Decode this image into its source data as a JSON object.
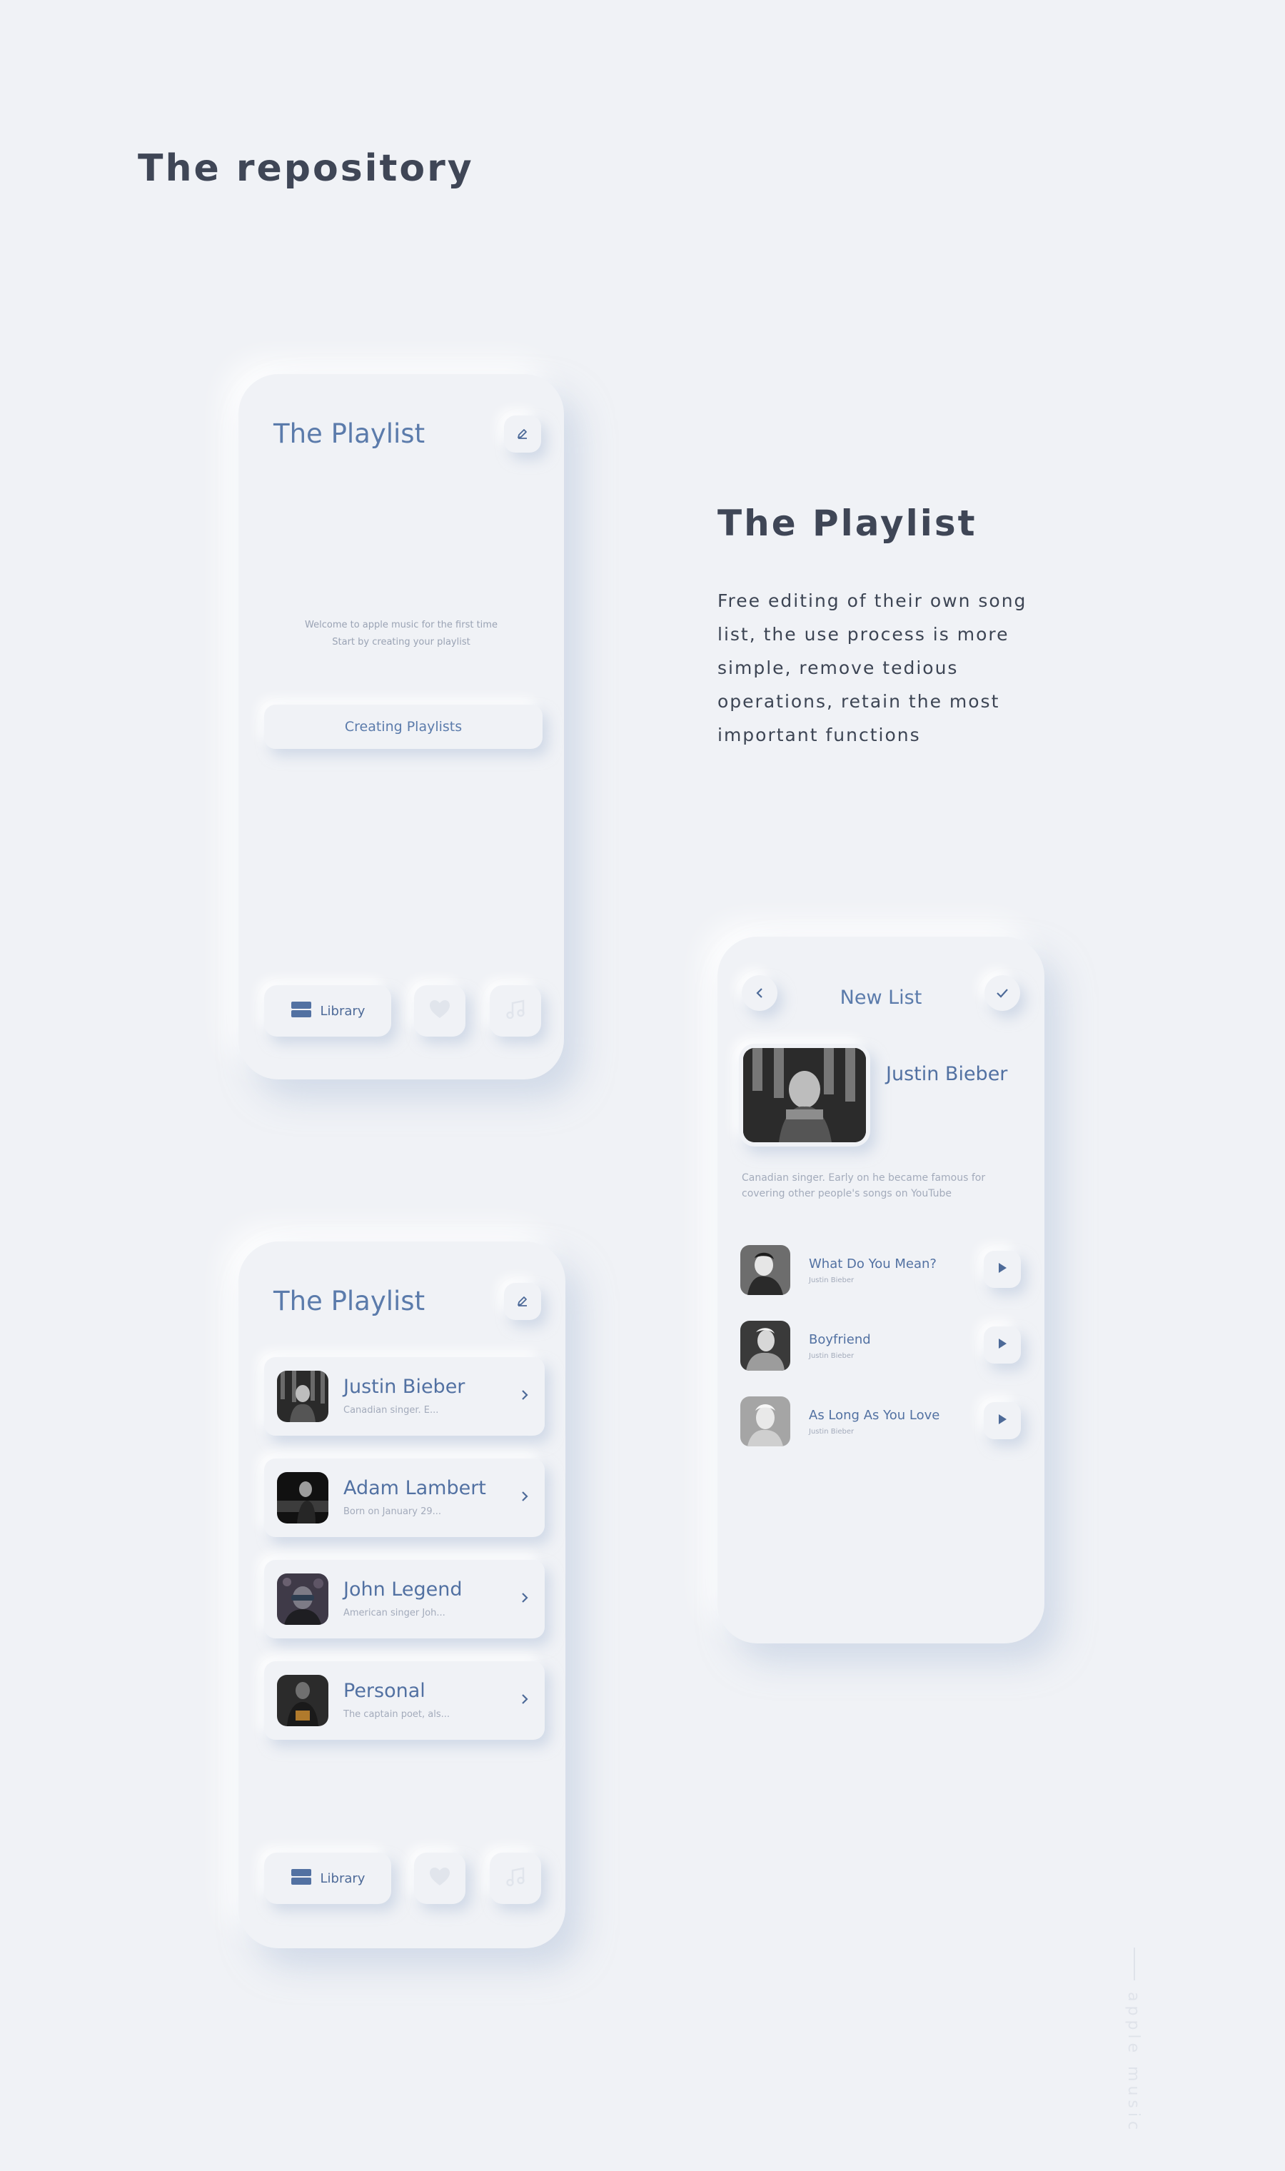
{
  "page": {
    "title": "The repository",
    "side_label": "apple music",
    "bg": "#f0f2f6",
    "accent": "#5b7bab"
  },
  "empty_playlist": {
    "title": "The Playlist",
    "edit_icon": "pencil-icon",
    "hint_line1": "Welcome to apple music for the first time",
    "hint_line2": "Start by creating your playlist",
    "create_button": "Creating Playlists",
    "tabbar": {
      "library": "Library",
      "library_icon": "library-icon",
      "heart_icon": "heart-icon",
      "music_icon": "music-note-icon"
    }
  },
  "description": {
    "title": "The Playlist",
    "text": "Free editing of their own song list, the use process is more simple, remove tedious operations, retain the most important functions"
  },
  "playlist": {
    "title": "The Playlist",
    "edit_icon": "pencil-icon",
    "items": [
      {
        "name": "Justin Bieber",
        "sub": "Canadian singer. E..."
      },
      {
        "name": "Adam Lambert",
        "sub": "Born on January 29..."
      },
      {
        "name": "John Legend",
        "sub": "American singer Joh..."
      },
      {
        "name": "Personal",
        "sub": "The captain poet, als..."
      }
    ],
    "tabbar": {
      "library": "Library",
      "library_icon": "library-icon",
      "heart_icon": "heart-icon",
      "music_icon": "music-note-icon"
    }
  },
  "new_list": {
    "title": "New List",
    "back_icon": "chevron-left-icon",
    "confirm_icon": "check-icon",
    "artist": "Justin Bieber",
    "bio_line1": "Canadian singer. Early on he became famous for",
    "bio_line2": "covering other people's songs on YouTube",
    "songs": [
      {
        "title": "What Do You Mean?",
        "artist": "Justin Bieber"
      },
      {
        "title": "Boyfriend",
        "artist": "Justin Bieber"
      },
      {
        "title": "As Long As You Love",
        "artist": "Justin Bieber"
      }
    ]
  }
}
